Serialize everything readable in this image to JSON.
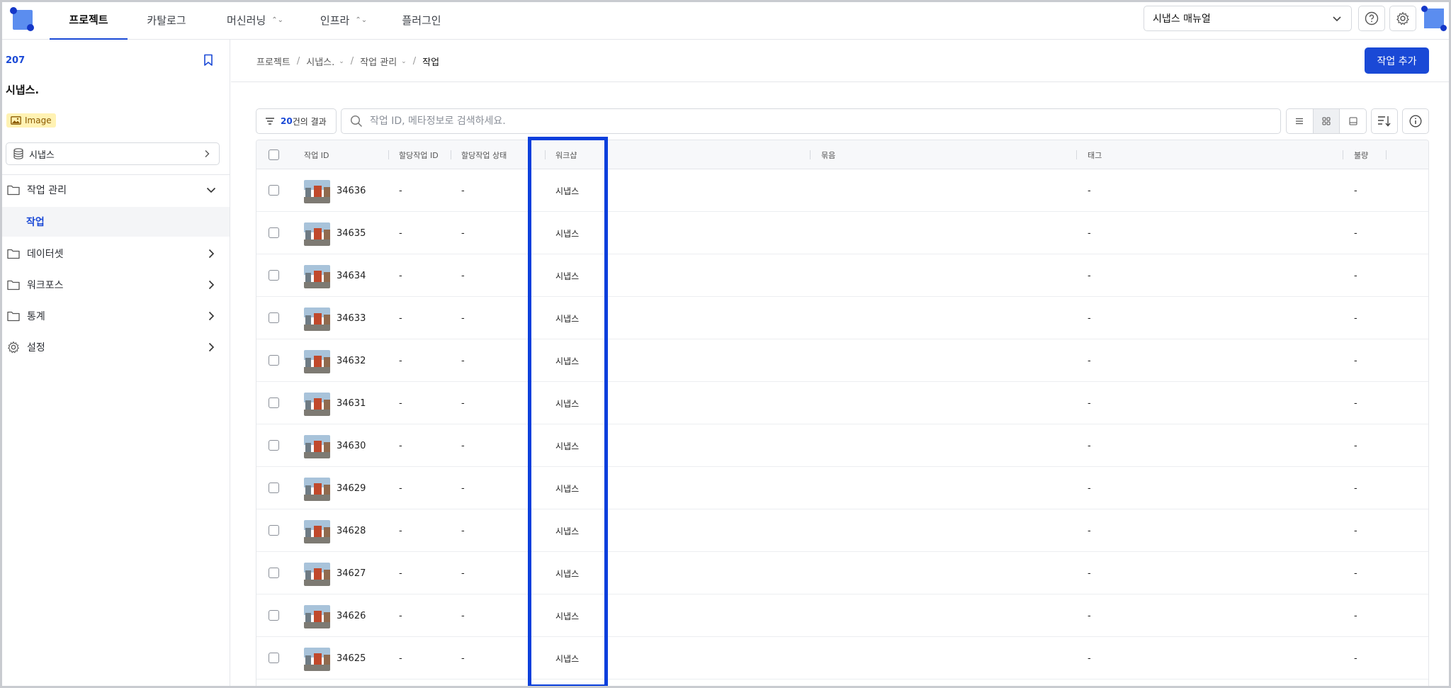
{
  "topnav": {
    "tabs": [
      {
        "label": "프로젝트",
        "active": true
      },
      {
        "label": "카탈로그",
        "active": false
      },
      {
        "label": "머신러닝",
        "active": false
      },
      {
        "label": "인프라",
        "active": false
      },
      {
        "label": "플러그인",
        "active": false
      }
    ],
    "manual_select": "시냅스 매뉴얼",
    "icons": [
      "help-icon",
      "gear-icon"
    ]
  },
  "sidebar": {
    "project_id": "207",
    "project_name": "시냅스.",
    "type_badge": "Image",
    "dataset": "시냅스",
    "menu": [
      {
        "label": "작업 관리",
        "icon": "folder-icon",
        "expanded": true
      },
      {
        "label": "작업",
        "sub": true,
        "active": true
      },
      {
        "label": "데이터셋",
        "icon": "folder-icon"
      },
      {
        "label": "워크포스",
        "icon": "folder-icon"
      },
      {
        "label": "통계",
        "icon": "folder-icon"
      },
      {
        "label": "설정",
        "icon": "gear-icon"
      }
    ]
  },
  "main": {
    "breadcrumb": [
      "프로젝트",
      "시냅스.",
      "작업 관리",
      "작업"
    ],
    "add_button": "작업 추가",
    "result_count": "20",
    "result_suffix": "건의 결과",
    "search_placeholder": "작업 ID, 메타정보로 검색하세요.",
    "columns": [
      "작업 ID",
      "할당작업 ID",
      "할당작업 상태",
      "워크샵",
      "묶음",
      "태그",
      "불량"
    ],
    "rows": [
      {
        "id": "34636",
        "assign_id": "-",
        "assign_status": "-",
        "workshop": "시냅스",
        "tag": "-",
        "defect": "-"
      },
      {
        "id": "34635",
        "assign_id": "-",
        "assign_status": "-",
        "workshop": "시냅스",
        "tag": "-",
        "defect": "-"
      },
      {
        "id": "34634",
        "assign_id": "-",
        "assign_status": "-",
        "workshop": "시냅스",
        "tag": "-",
        "defect": "-"
      },
      {
        "id": "34633",
        "assign_id": "-",
        "assign_status": "-",
        "workshop": "시냅스",
        "tag": "-",
        "defect": "-"
      },
      {
        "id": "34632",
        "assign_id": "-",
        "assign_status": "-",
        "workshop": "시냅스",
        "tag": "-",
        "defect": "-"
      },
      {
        "id": "34631",
        "assign_id": "-",
        "assign_status": "-",
        "workshop": "시냅스",
        "tag": "-",
        "defect": "-"
      },
      {
        "id": "34630",
        "assign_id": "-",
        "assign_status": "-",
        "workshop": "시냅스",
        "tag": "-",
        "defect": "-"
      },
      {
        "id": "34629",
        "assign_id": "-",
        "assign_status": "-",
        "workshop": "시냅스",
        "tag": "-",
        "defect": "-"
      },
      {
        "id": "34628",
        "assign_id": "-",
        "assign_status": "-",
        "workshop": "시냅스",
        "tag": "-",
        "defect": "-"
      },
      {
        "id": "34627",
        "assign_id": "-",
        "assign_status": "-",
        "workshop": "시냅스",
        "tag": "-",
        "defect": "-"
      },
      {
        "id": "34626",
        "assign_id": "-",
        "assign_status": "-",
        "workshop": "시냅스",
        "tag": "-",
        "defect": "-"
      },
      {
        "id": "34625",
        "assign_id": "-",
        "assign_status": "-",
        "workshop": "시냅스",
        "tag": "-",
        "defect": "-"
      }
    ]
  },
  "colors": {
    "accent": "#1a49d6",
    "highlight": "#0b3fdc",
    "badge_bg": "#fff2b3"
  }
}
